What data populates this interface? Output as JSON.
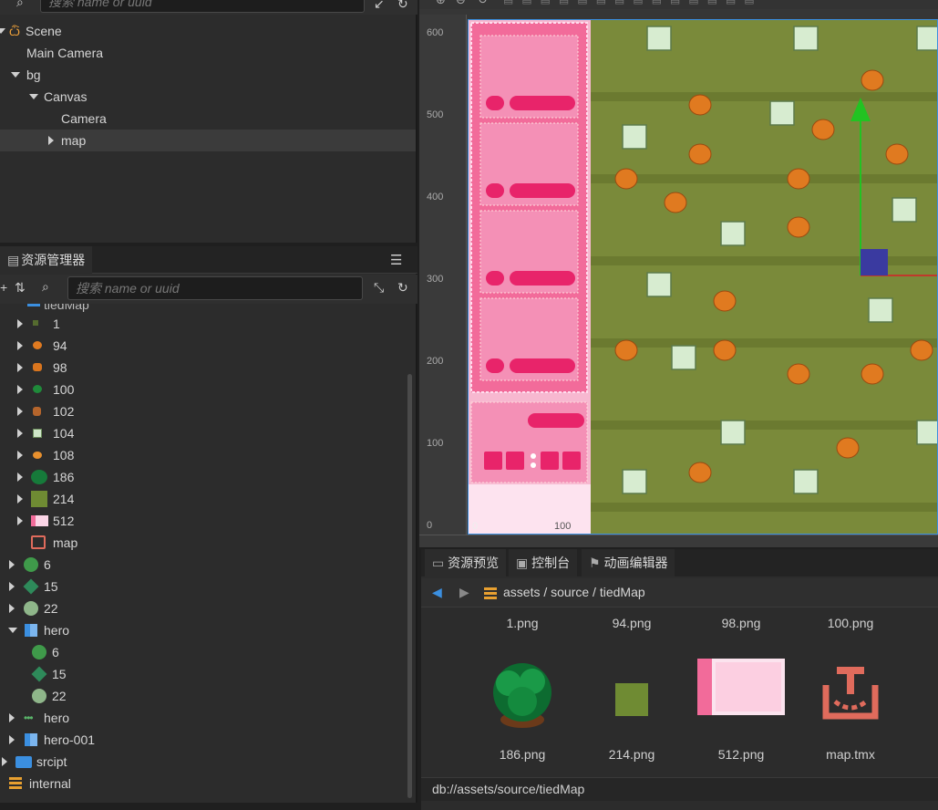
{
  "hierarchy": {
    "search_placeholder": "搜索 name or uuid",
    "nodes": [
      {
        "label": "Scene"
      },
      {
        "label": "Main Camera"
      },
      {
        "label": "bg"
      },
      {
        "label": "Canvas"
      },
      {
        "label": "Camera"
      },
      {
        "label": "map"
      }
    ]
  },
  "assets": {
    "tab_label": "资源管理器",
    "search_placeholder": "搜索 name or uuid",
    "partial_top_label": "tiedMap",
    "items": [
      {
        "label": "1"
      },
      {
        "label": "94"
      },
      {
        "label": "98"
      },
      {
        "label": "100"
      },
      {
        "label": "102"
      },
      {
        "label": "104"
      },
      {
        "label": "108"
      },
      {
        "label": "186"
      },
      {
        "label": "214"
      },
      {
        "label": "512"
      },
      {
        "label": "map"
      },
      {
        "label": "6"
      },
      {
        "label": "15"
      },
      {
        "label": "22"
      },
      {
        "label": "hero"
      },
      {
        "label": "6"
      },
      {
        "label": "15"
      },
      {
        "label": "22"
      },
      {
        "label": "hero"
      },
      {
        "label": "hero-001"
      },
      {
        "label": "srcipt"
      },
      {
        "label": "internal"
      }
    ]
  },
  "scene": {
    "ruler_v": [
      "600",
      "500",
      "400",
      "300",
      "200",
      "100",
      "0"
    ],
    "ruler_h": [
      "0",
      "100"
    ]
  },
  "preview": {
    "tabs": [
      {
        "label": "资源预览"
      },
      {
        "label": "控制台"
      },
      {
        "label": "动画编辑器"
      }
    ],
    "breadcrumb": [
      "assets",
      "source",
      "tiedMap"
    ],
    "files_row1": [
      "1.png",
      "94.png",
      "98.png",
      "100.png"
    ],
    "files_row2": [
      "186.png",
      "214.png",
      "512.png",
      "map.tmx"
    ],
    "status_path": "db://assets/source/tiedMap"
  },
  "colors": {
    "panel": "#2c2c2c",
    "selection": "#3b3b3b",
    "grass": "#7a8a3a",
    "pink": "#f26b9a",
    "accent_blue": "#3b8fe0",
    "gizmo_green": "#22c322",
    "gizmo_blue": "#3a3aa0"
  }
}
